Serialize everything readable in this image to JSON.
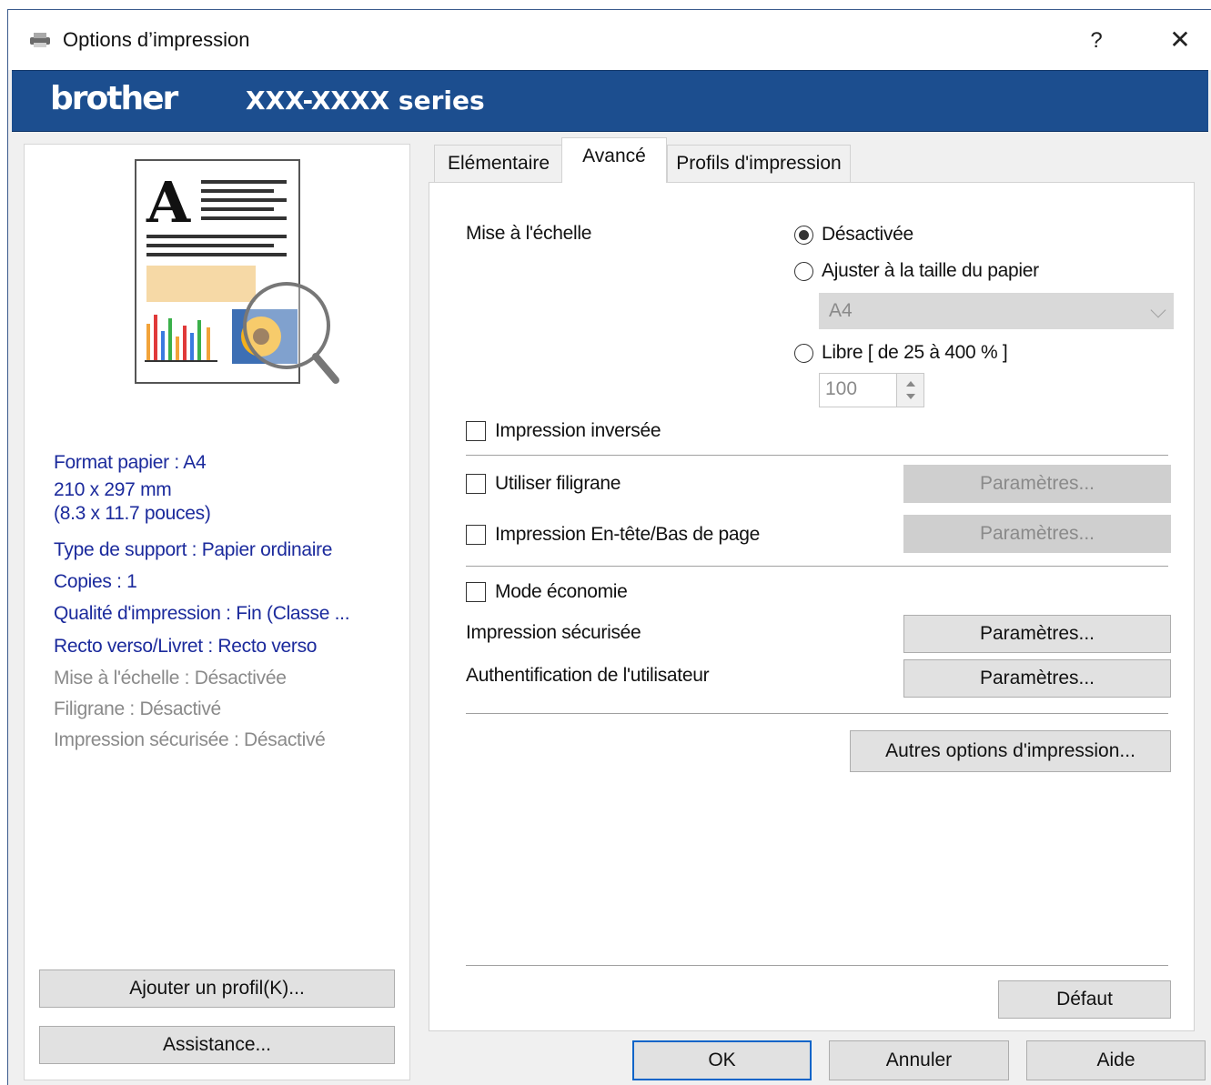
{
  "window": {
    "title": "Options d’impression",
    "help_label": "?",
    "close_label": "✕"
  },
  "banner": {
    "logo": "brother",
    "model": "XXX-XXXX series"
  },
  "summary": {
    "paper_format": "Format papier : A4",
    "paper_mm": "210 x 297 mm",
    "paper_in": "(8.3 x 11.7 pouces)",
    "media_type": "Type de support : Papier ordinaire",
    "copies": "Copies : 1",
    "quality": "Qualité d'impression : Fin (Classe ...",
    "duplex": "Recto verso/Livret : Recto verso",
    "scaling": "Mise à l'échelle : Désactivée",
    "watermark": "Filigrane : Désactivé",
    "secure": "Impression sécurisée : Désactivé"
  },
  "left_buttons": {
    "add_profile": "Ajouter un profil(K)...",
    "support": "Assistance..."
  },
  "tabs": [
    {
      "label": "Elémentaire",
      "active": false
    },
    {
      "label": "Avancé",
      "active": true
    },
    {
      "label": "Profils d'impression",
      "active": false
    }
  ],
  "advanced": {
    "scaling_label": "Mise à l'échelle",
    "scaling_options": [
      {
        "label": "Désactivée",
        "checked": true
      },
      {
        "label": "Ajuster à la taille du papier",
        "checked": false
      },
      {
        "label": "Libre [ de 25 à 400 % ]",
        "checked": false
      }
    ],
    "paper_size_value": "A4",
    "free_value": "100",
    "reverse_print": "Impression inversée",
    "watermark": "Utiliser filigrane",
    "header_footer": "Impression En-tête/Bas de page",
    "toner_save": "Mode économie",
    "secure_print": "Impression sécurisée",
    "user_auth": "Authentification de l'utilisateur",
    "settings_label": "Paramètres...",
    "other_options": "Autres options d'impression...",
    "default": "Défaut"
  },
  "footer": {
    "ok": "OK",
    "cancel": "Annuler",
    "help": "Aide"
  },
  "colors": {
    "banner": "#1c4e8f",
    "summary_text": "#1b2a9c",
    "disabled_text": "#8a8a8a",
    "focus_border": "#0a64c8"
  }
}
